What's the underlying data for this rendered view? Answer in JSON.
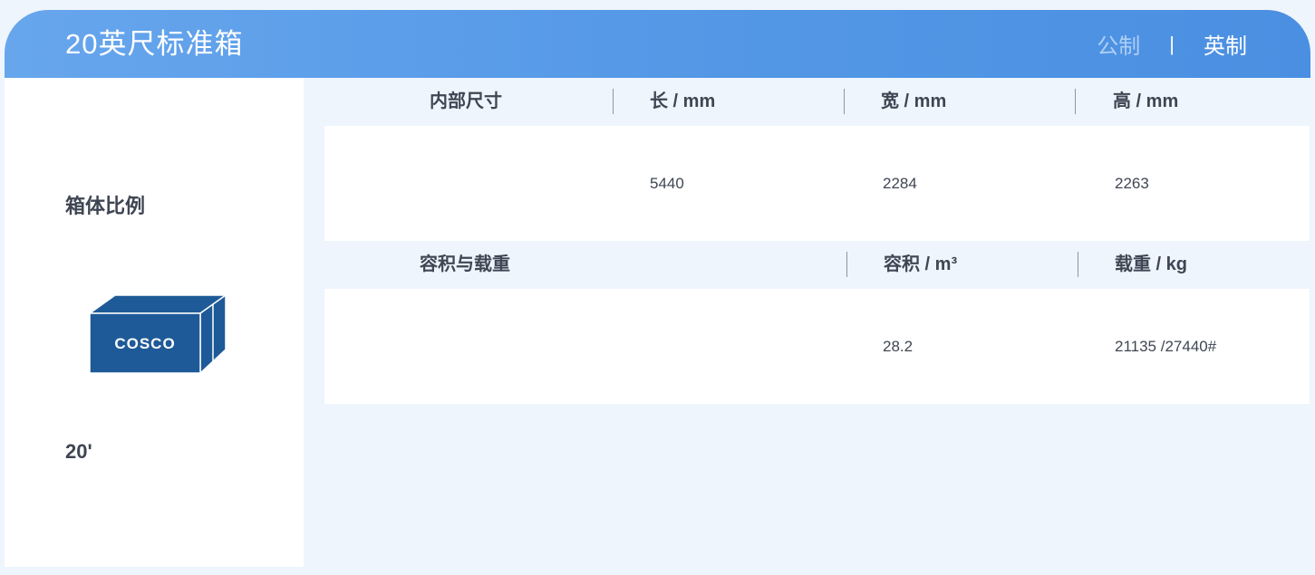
{
  "header": {
    "title": "20英尺标准箱",
    "unit_metric": "公制",
    "unit_separator": "|",
    "unit_imperial": "英制"
  },
  "side": {
    "ratio_label": "箱体比例",
    "container_logo_text": "COSCO",
    "size_label": "20'"
  },
  "dimensions": {
    "section_label": "内部尺寸",
    "columns": [
      "长 / mm",
      "宽 / mm",
      "高 / mm"
    ],
    "values": [
      "5440",
      "2284",
      "2263"
    ]
  },
  "capacity": {
    "section_label": "容积与载重",
    "columns": [
      "容积 / m³",
      "载重 / kg"
    ],
    "values": [
      "28.2",
      "21135 /27440#"
    ]
  },
  "colors": {
    "header_gradient_start": "#67a6ed",
    "header_gradient_end": "#4b8fe2",
    "page_background": "#eef5fc",
    "text_dark": "#3f4653",
    "container_blue": "#1f5a98"
  }
}
